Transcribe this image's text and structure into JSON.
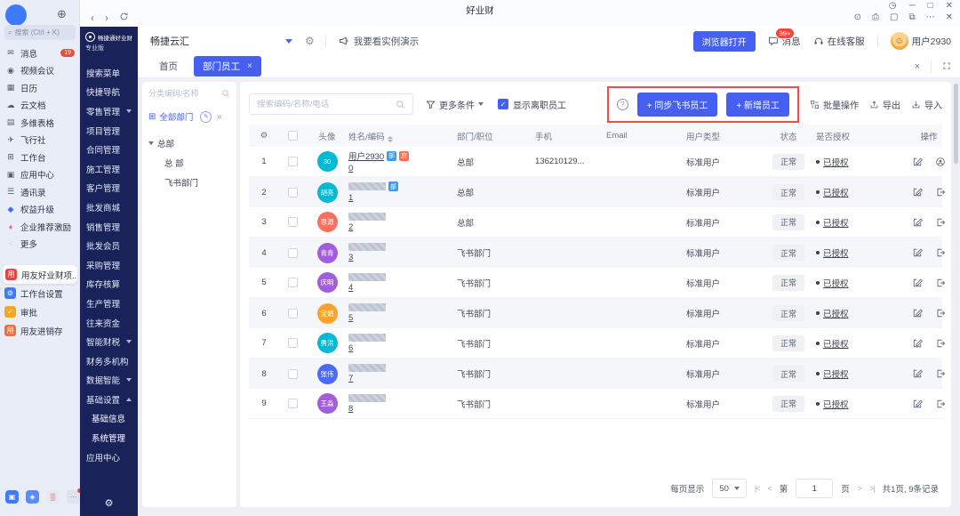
{
  "window": {
    "title": "好业财"
  },
  "rail": {
    "search_placeholder": "搜索 (Ctrl + K)",
    "items": [
      {
        "label": "消息",
        "icon": "message-icon",
        "badge": "19"
      },
      {
        "label": "视频会议",
        "icon": "video-icon"
      },
      {
        "label": "日历",
        "icon": "calendar-icon"
      },
      {
        "label": "云文档",
        "icon": "cloud-doc-icon"
      },
      {
        "label": "多维表格",
        "icon": "grid-table-icon"
      },
      {
        "label": "飞行社",
        "icon": "plane-icon"
      },
      {
        "label": "工作台",
        "icon": "workbench-icon"
      },
      {
        "label": "应用中心",
        "icon": "app-center-icon"
      },
      {
        "label": "通讯录",
        "icon": "contacts-icon"
      },
      {
        "label": "权益升级",
        "icon": "upgrade-diamond-icon",
        "color": "c-blue"
      },
      {
        "label": "企业推荐激励",
        "icon": "referral-icon",
        "color": "c-pink"
      },
      {
        "label": "更多",
        "icon": "more-icon",
        "color": "c-multi"
      }
    ],
    "pinned": [
      {
        "label": "用友好业财项..",
        "icon_bg": "#e8443c",
        "icon_char": "用",
        "active": true
      },
      {
        "label": "工作台设置",
        "icon_bg": "#3e7bfa",
        "icon_char": "⚙",
        "active": false
      },
      {
        "label": "审批",
        "icon_bg": "#f5a623",
        "icon_char": "✓",
        "active": false
      },
      {
        "label": "用友进销存",
        "icon_bg": "#f56d3b",
        "icon_char": "用",
        "active": false
      }
    ]
  },
  "sidebar": {
    "brand": "畅捷通好业财",
    "edition": "专业版",
    "items": [
      {
        "label": "搜索菜单"
      },
      {
        "label": "快捷导航"
      },
      {
        "label": "零售管理",
        "caret": "down"
      },
      {
        "label": "项目管理"
      },
      {
        "label": "合同管理"
      },
      {
        "label": "施工管理"
      },
      {
        "label": "客户管理"
      },
      {
        "label": "批发商城"
      },
      {
        "label": "销售管理"
      },
      {
        "label": "批发会员"
      },
      {
        "label": "采购管理"
      },
      {
        "label": "库存核算"
      },
      {
        "label": "生产管理"
      },
      {
        "label": "往来资金"
      },
      {
        "label": "智能财税",
        "caret": "down"
      },
      {
        "label": "财务多机构"
      },
      {
        "label": "数据智能",
        "caret": "down"
      },
      {
        "label": "基础设置",
        "caret": "up"
      },
      {
        "label": "基础信息",
        "indent": true
      },
      {
        "label": "系统管理",
        "indent": true
      },
      {
        "label": "应用中心"
      }
    ]
  },
  "header": {
    "company": "畅捷云汇",
    "demo_link": "我要看实例演示",
    "browser_open": "浏览器打开",
    "messages": "消息",
    "messages_badge": "99+",
    "support": "在线客服",
    "user": "用户2930"
  },
  "tabs": [
    {
      "label": "首页"
    },
    {
      "label": "部门员工",
      "active": true
    }
  ],
  "dept_panel": {
    "search_placeholder": "分类编码/名称",
    "all_label": "全部部门",
    "tree": [
      {
        "label": "总部",
        "child": false
      },
      {
        "label": "总 部",
        "child": true
      },
      {
        "label": "飞书部门",
        "child": true
      }
    ]
  },
  "toolbar": {
    "search_placeholder": "搜索编码/名称/电话",
    "more_filters": "更多条件",
    "show_resigned": "显示离职员工",
    "sync_button": "+ 同步飞书员工",
    "add_button": "+ 新增员工",
    "batch": "批量操作",
    "export": "导出",
    "import": "导入"
  },
  "table": {
    "columns": {
      "avatar": "头像",
      "name": "姓名/编码",
      "dept": "部门/职位",
      "phone": "手机",
      "email": "Email",
      "type": "用户类型",
      "status": "状态",
      "auth": "是否授权",
      "ops": "操作"
    },
    "rows": [
      {
        "idx": "1",
        "avatar_text": "30",
        "avatar_color": "#00b9d3",
        "name": "用户2930",
        "censored": false,
        "badges": [
          {
            "text": "部",
            "color": "#3b9bf0"
          },
          {
            "text": "应",
            "color": "#ff6f45"
          }
        ],
        "code": "0",
        "dept": "总部",
        "phone": "136210129...",
        "email": "",
        "type": "标准用户",
        "status": "正常",
        "auth": "已授权",
        "ops": [
          "edit",
          "account"
        ]
      },
      {
        "idx": "2",
        "avatar_text": "胡亮",
        "avatar_color": "#00b9d3",
        "censored": true,
        "badges": [
          {
            "text": "部",
            "color": "#3b9bf0"
          }
        ],
        "code": "1",
        "dept": "总部",
        "phone": "",
        "email": "",
        "type": "标准用户",
        "status": "正常",
        "auth": "已授权",
        "ops": [
          "edit",
          "leave"
        ]
      },
      {
        "idx": "3",
        "avatar_text": "思源",
        "avatar_color": "#fb6f5f",
        "censored": true,
        "badges": [],
        "code": "2",
        "dept": "总部",
        "phone": "",
        "email": "",
        "type": "标准用户",
        "status": "正常",
        "auth": "已授权",
        "ops": [
          "edit",
          "leave"
        ]
      },
      {
        "idx": "4",
        "avatar_text": "青青",
        "avatar_color": "#a25ddc",
        "censored": true,
        "badges": [],
        "code": "3",
        "dept": "飞书部门",
        "phone": "",
        "email": "",
        "type": "标准用户",
        "status": "正常",
        "auth": "已授权",
        "ops": [
          "edit",
          "leave"
        ]
      },
      {
        "idx": "5",
        "avatar_text": "庆明",
        "avatar_color": "#a25ddc",
        "censored": true,
        "badges": [],
        "code": "4",
        "dept": "飞书部门",
        "phone": "",
        "email": "",
        "type": "标准用户",
        "status": "正常",
        "auth": "已授权",
        "ops": [
          "edit",
          "leave"
        ]
      },
      {
        "idx": "6",
        "avatar_text": "宝娟",
        "avatar_color": "#ffa226",
        "censored": true,
        "badges": [],
        "code": "5",
        "dept": "飞书部门",
        "phone": "",
        "email": "",
        "type": "标准用户",
        "status": "正常",
        "auth": "已授权",
        "ops": [
          "edit",
          "leave"
        ]
      },
      {
        "idx": "7",
        "avatar_text": "勇洪",
        "avatar_color": "#00b9d3",
        "censored": true,
        "badges": [],
        "code": "6",
        "dept": "飞书部门",
        "phone": "",
        "email": "",
        "type": "标准用户",
        "status": "正常",
        "auth": "已授权",
        "ops": [
          "edit",
          "leave"
        ]
      },
      {
        "idx": "8",
        "avatar_text": "张伟",
        "avatar_color": "#4a6bfb",
        "censored": true,
        "badges": [],
        "code": "7",
        "dept": "飞书部门",
        "phone": "",
        "email": "",
        "type": "标准用户",
        "status": "正常",
        "auth": "已授权",
        "ops": [
          "edit",
          "leave"
        ]
      },
      {
        "idx": "9",
        "avatar_text": "王淼",
        "avatar_color": "#a25ddc",
        "censored": true,
        "badges": [],
        "code": "8",
        "dept": "飞书部门",
        "phone": "",
        "email": "",
        "type": "标准用户",
        "status": "正常",
        "auth": "已授权",
        "ops": [
          "edit",
          "leave"
        ]
      }
    ]
  },
  "pagination": {
    "per_page_label": "每页显示",
    "per_page": "50",
    "page_pre": "第",
    "page_value": "1",
    "page_post": "页",
    "summary": "共1页, 9条记录"
  },
  "colors": {
    "accent": "#4560f0",
    "sidebar_bg": "#19235a",
    "annotation": "#f54a45",
    "danger": "#f5483b"
  }
}
